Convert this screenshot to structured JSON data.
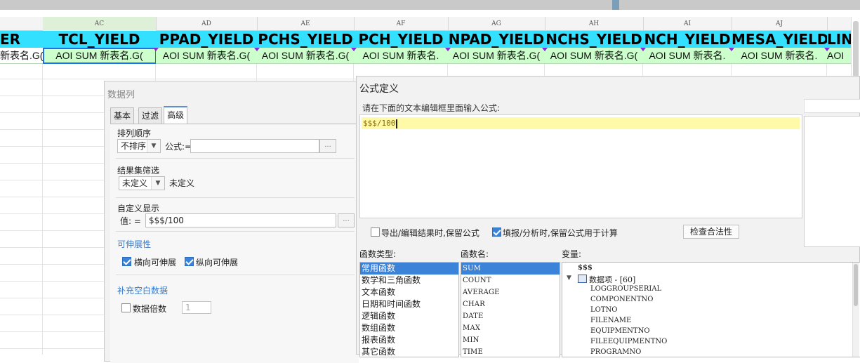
{
  "sheet": {
    "columns": [
      {
        "letter": "",
        "header": "ER",
        "cell": "新表名.G("
      },
      {
        "letter": "AC",
        "header": "TCL_YIELD",
        "cell": "AOI SUM 新表名.G("
      },
      {
        "letter": "AD",
        "header": "PPAD_YIELD",
        "cell": "AOI SUM 新表名.G("
      },
      {
        "letter": "AE",
        "header": "PCHS_YIELD",
        "cell": "AOI SUM 新表名.G("
      },
      {
        "letter": "AF",
        "header": "PCH_YIELD",
        "cell": "AOI SUM 新表名."
      },
      {
        "letter": "AG",
        "header": "NPAD_YIELD",
        "cell": "AOI SUM 新表名.G("
      },
      {
        "letter": "AH",
        "header": "NCHS_YIELD",
        "cell": "AOI SUM 新表名.G("
      },
      {
        "letter": "AI",
        "header": "NCH_YIELD",
        "cell": "AOI SUM 新表名."
      },
      {
        "letter": "AJ",
        "header": "MESA_YIELD",
        "cell": "AOI SUM 新表名."
      },
      {
        "letter": "",
        "header": "LIN",
        "cell": "AOI"
      }
    ],
    "header_color": "#33e0ff",
    "cell_color": "#ccffcc"
  },
  "column_dialog": {
    "title": "数据列",
    "tabs": [
      "基本",
      "过滤",
      "高级"
    ],
    "active_tab": "高级",
    "sort_section": "排列顺序",
    "sort_value": "不排序",
    "formula_label": "公式:=",
    "filter_section": "结果集筛选",
    "filter_value": "未定义",
    "filter_text": "未定义",
    "custom_display": "自定义显示",
    "value_label": "值:  =",
    "value_field": "$$$/100",
    "dots": "...",
    "stretch_section": "可伸展性",
    "horizontal_stretch": "横向可伸展",
    "vertical_stretch": "纵向可伸展",
    "fill_section": "补充空白数据",
    "data_multiple": "数据倍数",
    "multiple_value": "1"
  },
  "formula_dialog": {
    "title": "公式定义",
    "hint": "请在下面的文本编辑框里面输入公式:",
    "formula": "$$$/100",
    "keep_formula_export": "导出/编辑结果时,保留公式",
    "keep_formula_fill": "填报/分析时,保留公式用于计算",
    "check_button": "检查合法性",
    "function_type_label": "函数类型:",
    "function_name_label": "函数名:",
    "variable_label": "变量:",
    "function_types": [
      "常用函数",
      "数学和三角函数",
      "文本函数",
      "日期和时间函数",
      "逻辑函数",
      "数组函数",
      "报表函数",
      "其它函数"
    ],
    "function_names": [
      "SUM",
      "COUNT",
      "AVERAGE",
      "CHAR",
      "DATE",
      "MAX",
      "MIN",
      "TIME"
    ],
    "variables": {
      "root": "$$$",
      "group": "数据项 - [60]",
      "items": [
        "LOGGROUPSERIAL",
        "COMPONENTNO",
        "LOTNO",
        "FILENAME",
        "EQUIPMENTNO",
        "FILEEQUIPMENTNO",
        "PROGRAMNO"
      ]
    }
  }
}
